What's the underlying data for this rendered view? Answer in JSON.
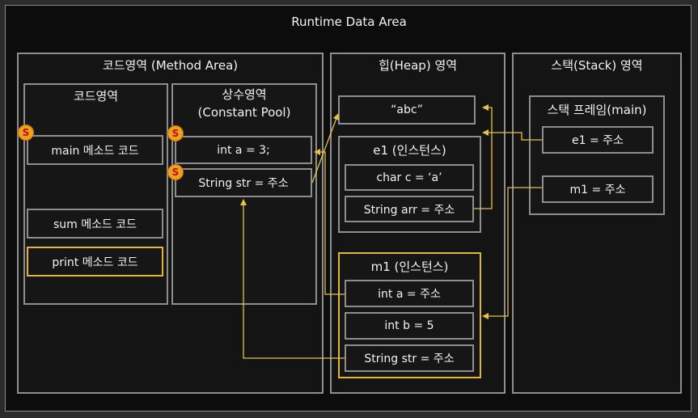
{
  "title": "Runtime Data Area",
  "method_area": {
    "title": "코드영역 (Method Area)",
    "code": {
      "title": "코드영역",
      "items": [
        "main 메소드 코드",
        "sum 메소드 코드",
        "print 메소드 코드"
      ]
    },
    "constant_pool": {
      "title_line1": "상수영역",
      "title_line2": "(Constant Pool)",
      "items": [
        "int a = 3;",
        "String str = 주소"
      ]
    }
  },
  "heap": {
    "title": "힙(Heap) 영역",
    "abc": "“abc”",
    "e1": {
      "title": "e1 (인스턴스)",
      "items": [
        "char c = ‘a’",
        "String arr = 주소"
      ]
    },
    "m1": {
      "title": "m1 (인스턴스)",
      "items": [
        "int a = 주소",
        "int b = 5",
        "String str = 주소"
      ]
    }
  },
  "stack": {
    "title": "스택(Stack) 영역",
    "frame": {
      "title": "스택 프레임(main)",
      "items": [
        "e1 = 주소",
        "m1 = 주소"
      ]
    }
  },
  "badge": "S",
  "colors": {
    "highlight": "#e3b43a",
    "arrow": "#e6c04a",
    "border": "#8e8e8e",
    "background": "#0c0c0c"
  }
}
